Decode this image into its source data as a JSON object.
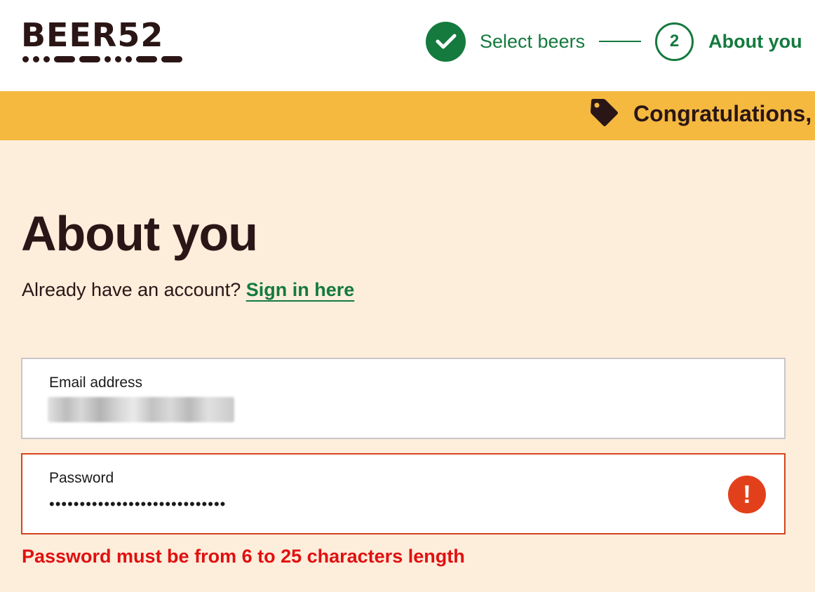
{
  "header": {
    "logo_text": "BEER52",
    "steps": [
      {
        "label": "Select beers",
        "state": "done",
        "icon": "check-icon"
      },
      {
        "number": "2",
        "label": "About you",
        "state": "active"
      }
    ]
  },
  "promo": {
    "icon": "tag-icon",
    "text": "Congratulations, y"
  },
  "main": {
    "title": "About you",
    "signin_prompt": "Already have an account?",
    "signin_link": "Sign in here"
  },
  "form": {
    "email": {
      "label": "Email address",
      "value_state": "redacted"
    },
    "password": {
      "label": "Password",
      "masked_value": "•••••••••••••••••••••••••••••",
      "error_icon": "!"
    },
    "error_message": "Password must be from 6 to 25 characters length"
  },
  "colors": {
    "brand_green": "#147a3e",
    "promo_yellow": "#f5b940",
    "page_background": "#fdeddb",
    "error_red": "#e01010",
    "error_border": "#d4451c",
    "text_dark": "#2a1616"
  }
}
